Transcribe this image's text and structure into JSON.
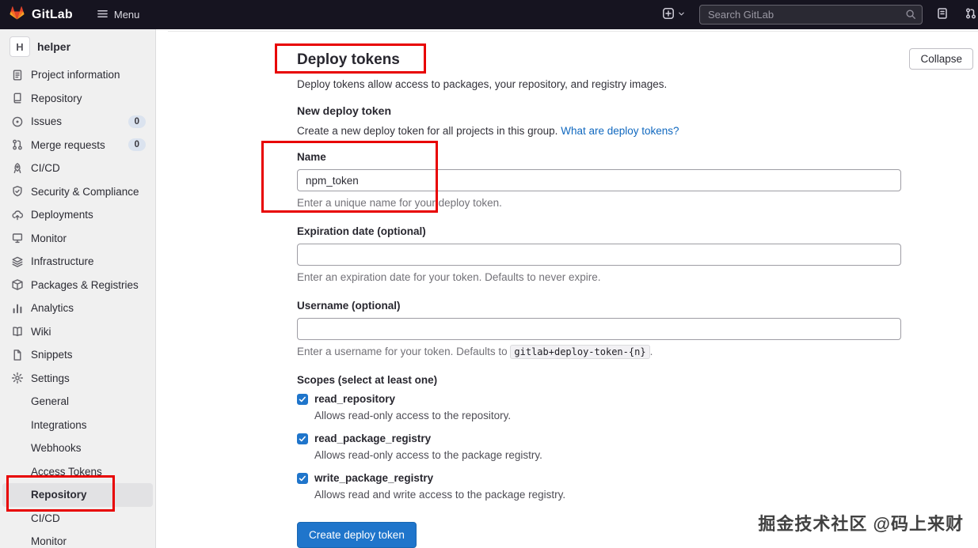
{
  "topbar": {
    "brand": "GitLab",
    "menu_label": "Menu",
    "search_placeholder": "Search GitLab",
    "icons": [
      "tanuki-logo",
      "hamburger-icon",
      "plus-menu-icon",
      "chevron-down-icon",
      "search-icon",
      "clipboard-icon",
      "merge-request-icon"
    ]
  },
  "sidebar": {
    "project": {
      "avatar": "H",
      "name": "helper"
    },
    "items": [
      {
        "label": "Project information",
        "icon": "project-information-icon"
      },
      {
        "label": "Repository",
        "icon": "repository-icon"
      },
      {
        "label": "Issues",
        "icon": "issues-icon",
        "badge": "0"
      },
      {
        "label": "Merge requests",
        "icon": "merge-requests-icon",
        "badge": "0"
      },
      {
        "label": "CI/CD",
        "icon": "ci-cd-icon"
      },
      {
        "label": "Security & Compliance",
        "icon": "shield-icon"
      },
      {
        "label": "Deployments",
        "icon": "deployments-icon"
      },
      {
        "label": "Monitor",
        "icon": "monitor-icon"
      },
      {
        "label": "Infrastructure",
        "icon": "infrastructure-icon"
      },
      {
        "label": "Packages & Registries",
        "icon": "package-icon"
      },
      {
        "label": "Analytics",
        "icon": "analytics-icon"
      },
      {
        "label": "Wiki",
        "icon": "wiki-icon"
      },
      {
        "label": "Snippets",
        "icon": "snippets-icon"
      },
      {
        "label": "Settings",
        "icon": "gear-icon"
      }
    ],
    "settings_subitems": [
      {
        "label": "General",
        "active": false
      },
      {
        "label": "Integrations",
        "active": false
      },
      {
        "label": "Webhooks",
        "active": false
      },
      {
        "label": "Access Tokens",
        "active": false
      },
      {
        "label": "Repository",
        "active": true
      },
      {
        "label": "CI/CD",
        "active": false
      },
      {
        "label": "Monitor",
        "active": false
      }
    ]
  },
  "main": {
    "title": "Deploy tokens",
    "subtitle": "Deploy tokens allow access to packages, your repository, and registry images.",
    "collapse_button": "Collapse",
    "section_title": "New deploy token",
    "section_desc": "Create a new deploy token for all projects in this group.",
    "section_link": "What are deploy tokens?",
    "fields": {
      "name": {
        "label": "Name",
        "value": "npm_token",
        "help": "Enter a unique name for your deploy token."
      },
      "expiration": {
        "label": "Expiration date (optional)",
        "value": "",
        "help": "Enter an expiration date for your token. Defaults to never expire."
      },
      "username": {
        "label": "Username (optional)",
        "value": "",
        "help_prefix": "Enter a username for your token. Defaults to ",
        "help_code": "gitlab+deploy-token-{n}",
        "help_suffix": "."
      }
    },
    "scopes": {
      "label": "Scopes (select at least one)",
      "options": [
        {
          "name": "read_repository",
          "desc": "Allows read-only access to the repository.",
          "checked": true
        },
        {
          "name": "read_package_registry",
          "desc": "Allows read-only access to the package registry.",
          "checked": true
        },
        {
          "name": "write_package_registry",
          "desc": "Allows read and write access to the package registry.",
          "checked": true
        }
      ]
    },
    "submit_button": "Create deploy token"
  },
  "annotations": {
    "count": 3,
    "color": "#e80000",
    "targets": [
      "page-title",
      "name-field",
      "sidebar-subitem-repository"
    ]
  },
  "watermark": "掘金技术社区 @码上来财",
  "colors": {
    "navbar": "#161420",
    "sidebar": "#f0f0f0",
    "accent": "#1f75cb",
    "link": "#1068bf",
    "annotation": "#e80000"
  }
}
